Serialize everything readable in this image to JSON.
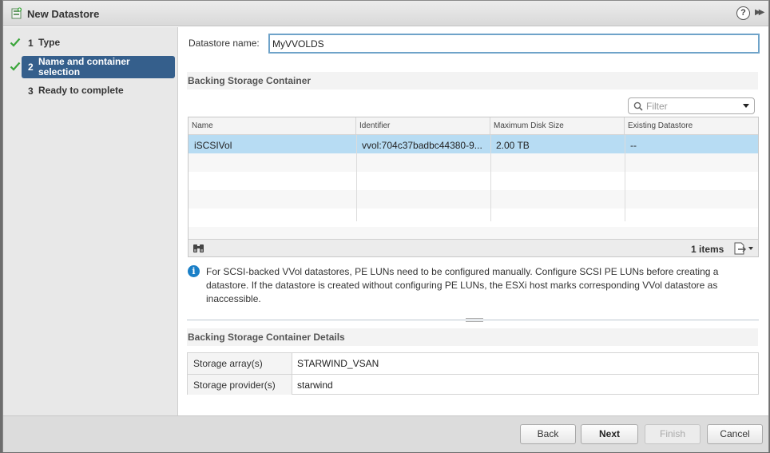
{
  "dialog": {
    "title": "New Datastore",
    "icons": {
      "title": "datastore-add-icon",
      "help": "help-icon",
      "expand": "expand-icon"
    },
    "help_glyph": "?"
  },
  "steps": [
    {
      "num": "1",
      "label": "Type",
      "completed": true,
      "active": false
    },
    {
      "num": "2",
      "label": "Name and container selection",
      "completed": true,
      "active": true
    },
    {
      "num": "3",
      "label": "Ready to complete",
      "completed": false,
      "active": false
    }
  ],
  "form": {
    "name_label": "Datastore name:",
    "name_value": "MyVVOLDS"
  },
  "backing": {
    "section_title": "Backing Storage Container",
    "filter_placeholder": "Filter",
    "columns": [
      "Name",
      "Identifier",
      "Maximum Disk Size",
      "Existing Datastore"
    ],
    "rows": [
      [
        "iSCSIVol",
        "vvol:704c37badbc44380-9...",
        "2.00 TB",
        "--"
      ]
    ],
    "items_count": "1 items"
  },
  "info": {
    "glyph": "i",
    "text": "For SCSI-backed VVol datastores, PE LUNs need to be configured manually. Configure SCSI PE LUNs before creating a datastore. If the datastore is created without configuring PE LUNs, the ESXi host marks corresponding VVol datastore as inaccessible."
  },
  "details": {
    "section_title": "Backing Storage Container Details",
    "rows": [
      {
        "label": "Storage array(s)",
        "value": "STARWIND_VSAN"
      },
      {
        "label": "Storage provider(s)",
        "value": "starwind"
      }
    ]
  },
  "buttons": {
    "back": "Back",
    "next": "Next",
    "finish": "Finish",
    "cancel": "Cancel"
  },
  "colors": {
    "active_step": "#355f8c",
    "selected_row": "#b7dcf3",
    "check": "#3aa53a",
    "info": "#1a7fc7",
    "input_border": "#6fa3c9"
  }
}
